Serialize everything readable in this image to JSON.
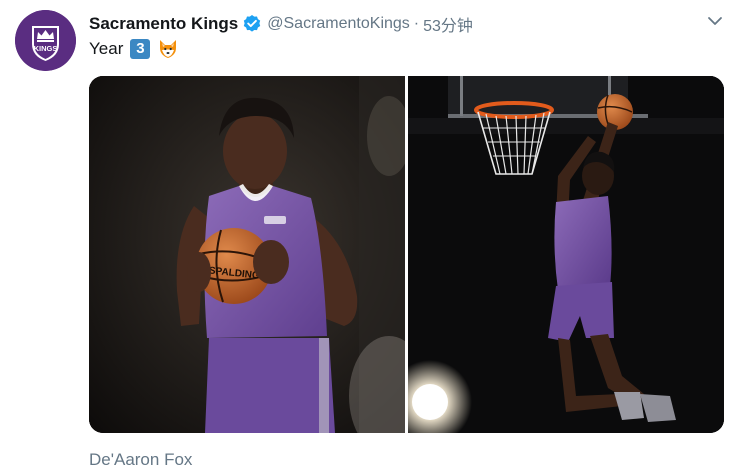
{
  "tweet": {
    "display_name": "Sacramento Kings",
    "handle": "@SacramentoKings",
    "separator": "·",
    "time": "53分钟",
    "text": "Year",
    "keycap_number": "3",
    "fox_emoji": "fox-icon",
    "verified_icon": "verified-badge-icon",
    "menu_icon": "chevron-down-icon",
    "avatar_logo": "SACRAMENTO KINGS",
    "caption": "De'Aaron Fox"
  },
  "colors": {
    "brand_purple": "#5a2d81",
    "verified_blue": "#1da1f2",
    "secondary_text": "#657786",
    "keycap_blue": "#3b88c3"
  },
  "media": {
    "photo_count": 2
  }
}
